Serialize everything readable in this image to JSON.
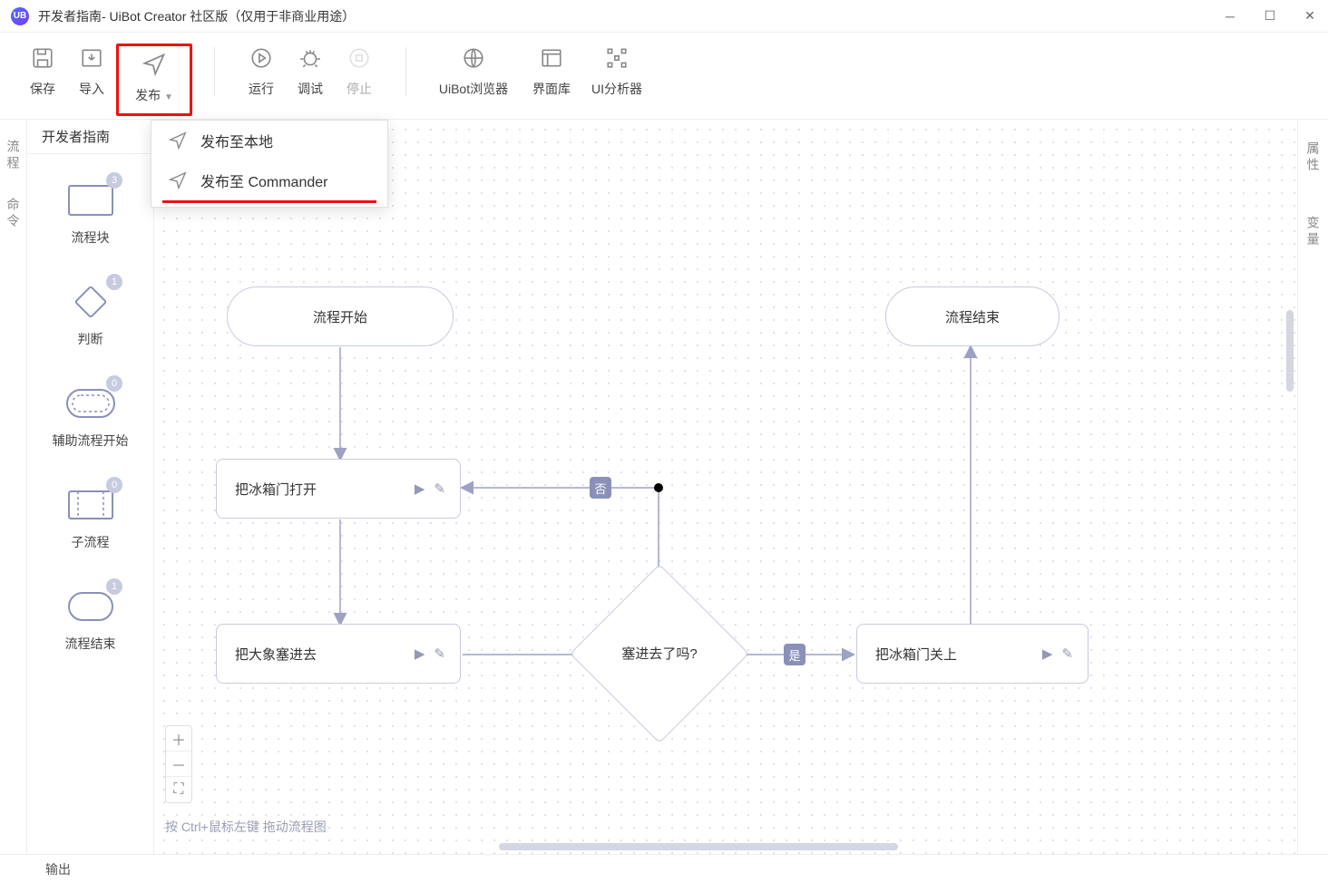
{
  "window": {
    "title": "开发者指南- UiBot Creator 社区版（仅用于非商业用途）",
    "logo_text": "UB"
  },
  "toolbar": {
    "save": "保存",
    "import": "导入",
    "publish": "发布",
    "run": "运行",
    "debug": "调试",
    "stop": "停止",
    "browser": "UiBot浏览器",
    "ui_lib": "界面库",
    "ui_analyzer": "UI分析器"
  },
  "publish_menu": {
    "local": "发布至本地",
    "commander": "发布至 Commander"
  },
  "left_tabs": {
    "flow": "流程",
    "command": "命令"
  },
  "palette": {
    "tab": "开发者指南",
    "items": [
      {
        "label": "流程块",
        "badge": "3"
      },
      {
        "label": "判断",
        "badge": "1"
      },
      {
        "label": "辅助流程开始",
        "badge": "0"
      },
      {
        "label": "子流程",
        "badge": "0"
      },
      {
        "label": "流程结束",
        "badge": "1"
      }
    ]
  },
  "canvas": {
    "start": "流程开始",
    "end": "流程结束",
    "node1": "把冰箱门打开",
    "node2": "把大象塞进去",
    "node3": "把冰箱门关上",
    "decision": "塞进去了吗?",
    "edge_no": "否",
    "edge_yes": "是",
    "hint": "按 Ctrl+鼠标左键 拖动流程图"
  },
  "right_tabs": {
    "props": "属性",
    "vars": "变量"
  },
  "bottom": {
    "output": "输出"
  }
}
